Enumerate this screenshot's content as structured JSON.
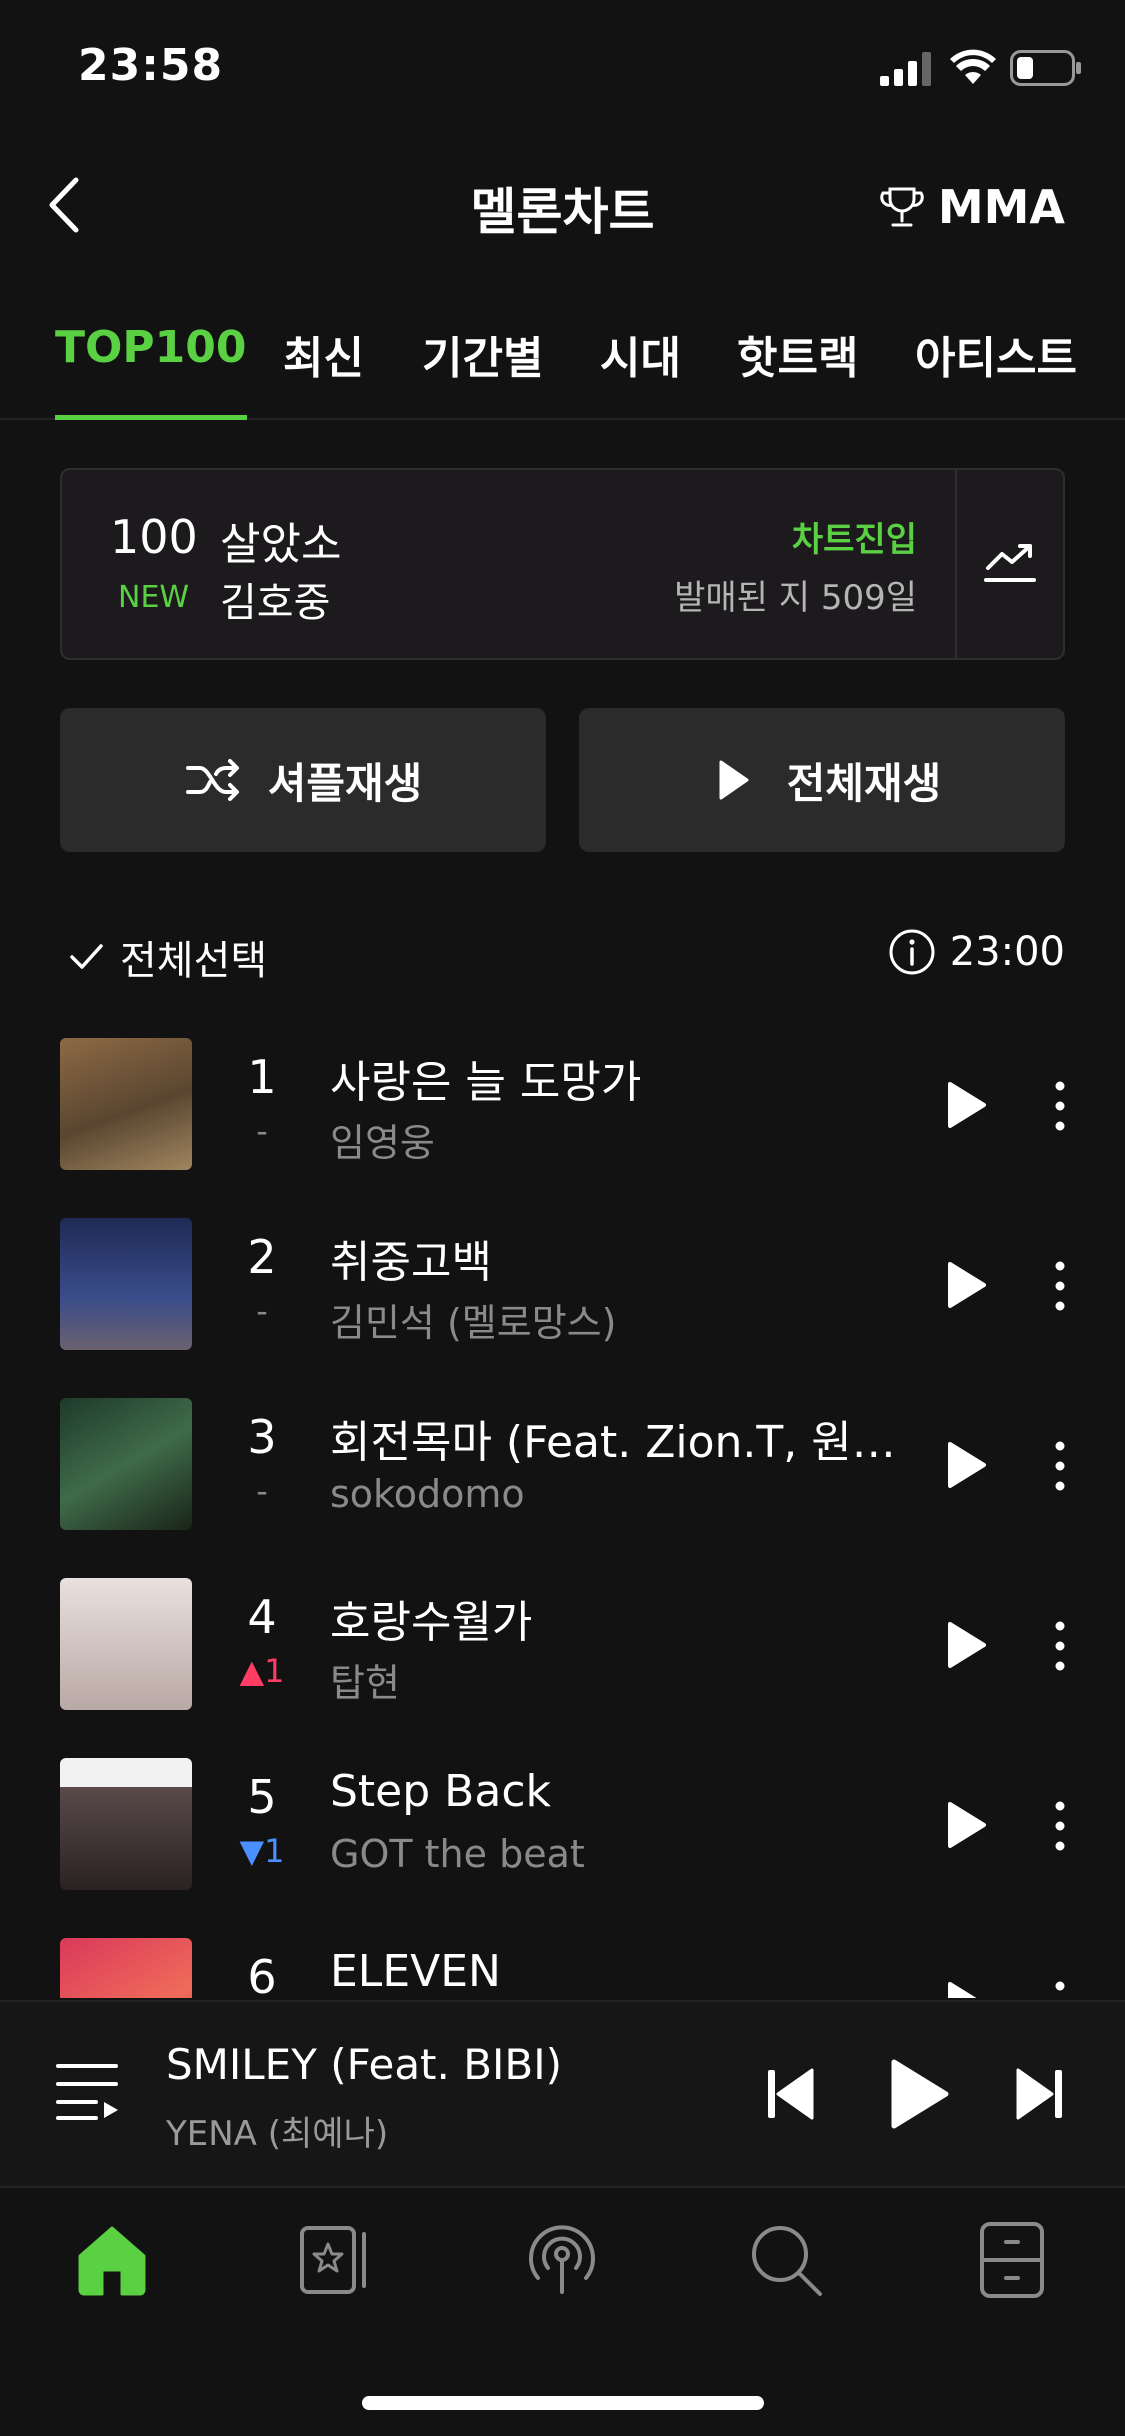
{
  "status_bar": {
    "time": "23:58"
  },
  "header": {
    "title": "멜론차트",
    "right_label": "MMA"
  },
  "tabs": [
    {
      "label": "TOP100",
      "active": true
    },
    {
      "label": "최신"
    },
    {
      "label": "기간별"
    },
    {
      "label": "시대"
    },
    {
      "label": "핫트랙"
    },
    {
      "label": "아티스트"
    }
  ],
  "new_entry": {
    "rank": "100",
    "badge": "NEW",
    "song": "살았소",
    "artist": "김호중",
    "status": "차트진입",
    "released": "발매된 지 509일"
  },
  "buttons": {
    "shuffle": "셔플재생",
    "play_all": "전체재생"
  },
  "select_bar": {
    "select_all": "전체선택",
    "updated_time": "23:00"
  },
  "chart_list": [
    {
      "rank": "1",
      "change": "-",
      "change_type": "same",
      "title": "사랑은 늘 도망가",
      "artist": "임영웅"
    },
    {
      "rank": "2",
      "change": "-",
      "change_type": "same",
      "title": "취중고백",
      "artist": "김민석 (멜로망스)"
    },
    {
      "rank": "3",
      "change": "-",
      "change_type": "same",
      "title": "회전목마 (Feat. Zion.T, 원슈…",
      "artist": "sokodomo"
    },
    {
      "rank": "4",
      "change": "▲1",
      "change_type": "up",
      "title": "호랑수월가",
      "artist": "탑현"
    },
    {
      "rank": "5",
      "change": "▼1",
      "change_type": "down",
      "title": "Step Back",
      "artist": "GOT the beat"
    },
    {
      "rank": "6",
      "change": "",
      "change_type": "same",
      "title": "ELEVEN",
      "artist": ""
    }
  ],
  "mini_player": {
    "title": "SMILEY (Feat. BIBI)",
    "artist": "YENA (최예나)"
  },
  "bottom_nav": [
    "home-icon",
    "my-music-icon",
    "podcast-icon",
    "search-icon",
    "library-icon"
  ],
  "colors": {
    "accent": "#5ad043",
    "up": "#ff3c64",
    "down": "#4a90ff",
    "background": "#121212"
  }
}
